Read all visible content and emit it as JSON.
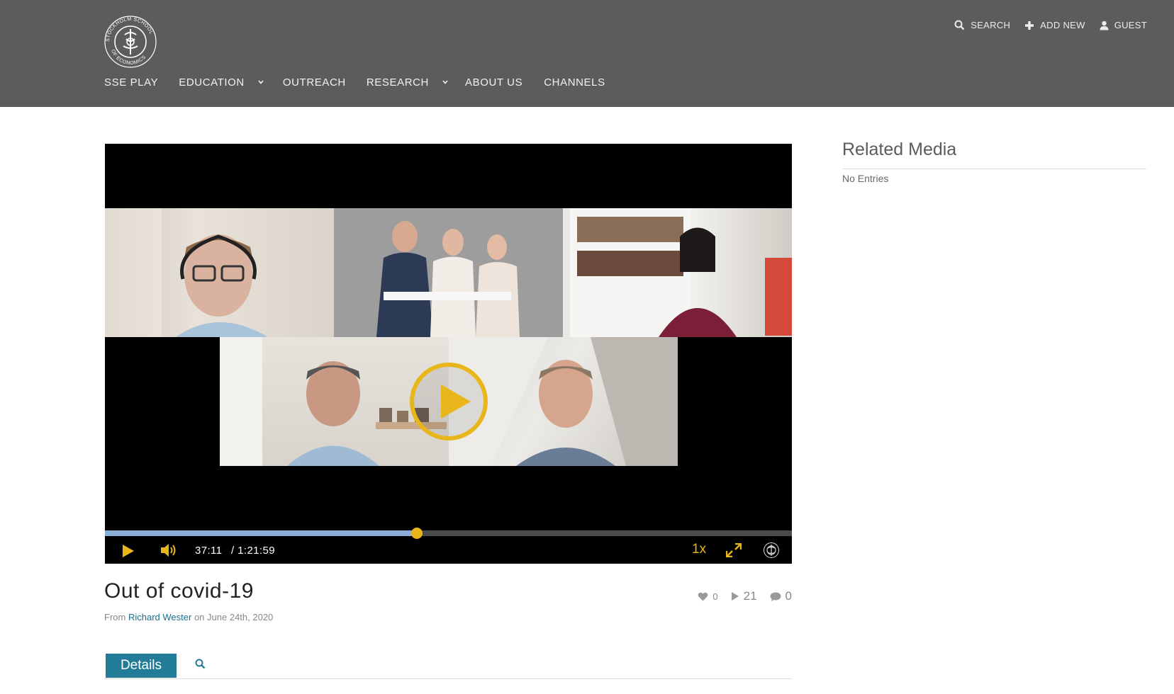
{
  "brand": {
    "logo_text": "STOCKHOLM SCHOOL OF ECONOMICS",
    "logo_icon": "sse-seal-icon"
  },
  "nav": {
    "items": [
      {
        "label": "SSE PLAY",
        "has_dropdown": false
      },
      {
        "label": "EDUCATION",
        "has_dropdown": true
      },
      {
        "label": "OUTREACH",
        "has_dropdown": false
      },
      {
        "label": "RESEARCH",
        "has_dropdown": true
      },
      {
        "label": "ABOUT US",
        "has_dropdown": false
      },
      {
        "label": "CHANNELS",
        "has_dropdown": false
      }
    ]
  },
  "topbar": {
    "search_label": "SEARCH",
    "add_new_label": "ADD NEW",
    "user_label": "GUEST"
  },
  "player": {
    "current_time": "37:11",
    "duration": "/ 1:21:59",
    "progress_fraction": 0.454,
    "speed": "1x",
    "colors": {
      "accent": "#e8b51b",
      "played": "#8aaed8"
    }
  },
  "media": {
    "title": "Out of covid-19",
    "from_label": "From",
    "author": "Richard Wester",
    "on_label": "on",
    "date": "June 24th, 2020",
    "likes": "0",
    "plays": "21",
    "comments": "0"
  },
  "tabs": {
    "details_label": "Details"
  },
  "sidebar": {
    "title": "Related Media",
    "empty_text": "No Entries"
  },
  "colors": {
    "header_bg": "#5c5c5c",
    "tab_active": "#237c97",
    "link": "#1b6f8a"
  }
}
